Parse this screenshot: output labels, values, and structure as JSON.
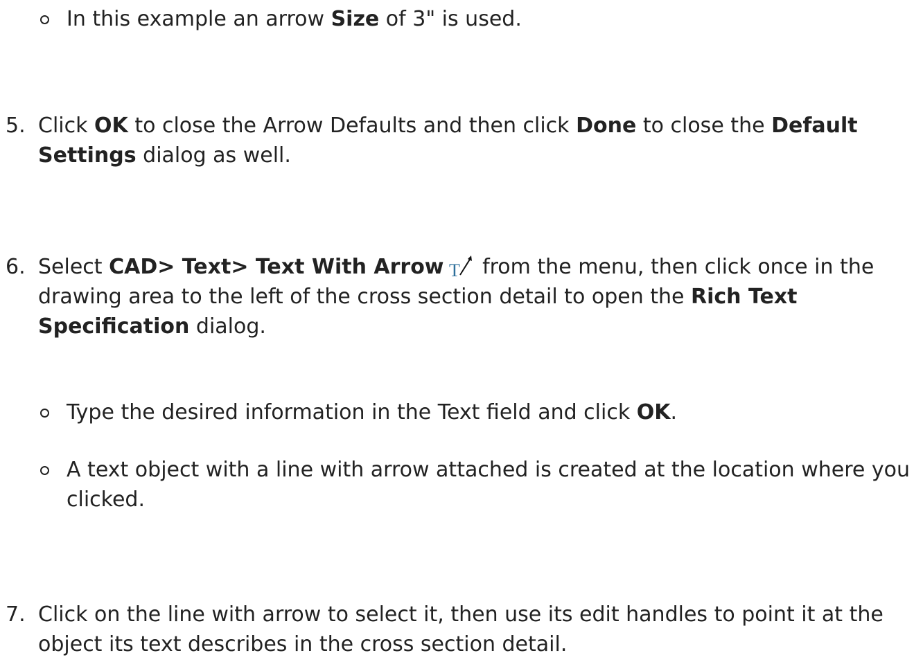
{
  "bullets_top": [
    {
      "pre": "In this example an arrow ",
      "b1": "Size",
      "post": " of 3\" is used."
    }
  ],
  "step5": {
    "num": "5.",
    "t1": "Click ",
    "b1": "OK",
    "t2": " to close the Arrow Defaults and then click ",
    "b2": "Done",
    "t3": " to close the ",
    "b3": "Default Settings",
    "t4": " dialog as well."
  },
  "step6": {
    "num": "6.",
    "t1": "Select ",
    "b1": "CAD> Text> Text With Arrow",
    "icon": "text-with-arrow-icon",
    "t2": " from the menu, then click once in the drawing area to the left of the cross section detail to open the ",
    "b2": "Rich Text Specification",
    "t3": " dialog.",
    "sub1": {
      "t1": "Type the desired information in the Text field and click ",
      "b1": "OK",
      "t2": "."
    },
    "sub2": {
      "t1": "A text object with a line with arrow attached is created at the location where you clicked."
    }
  },
  "step7": {
    "num": "7.",
    "t1": "Click on the line with arrow to select it, then use its edit handles to point it at the object its text describes in the cross section detail."
  }
}
